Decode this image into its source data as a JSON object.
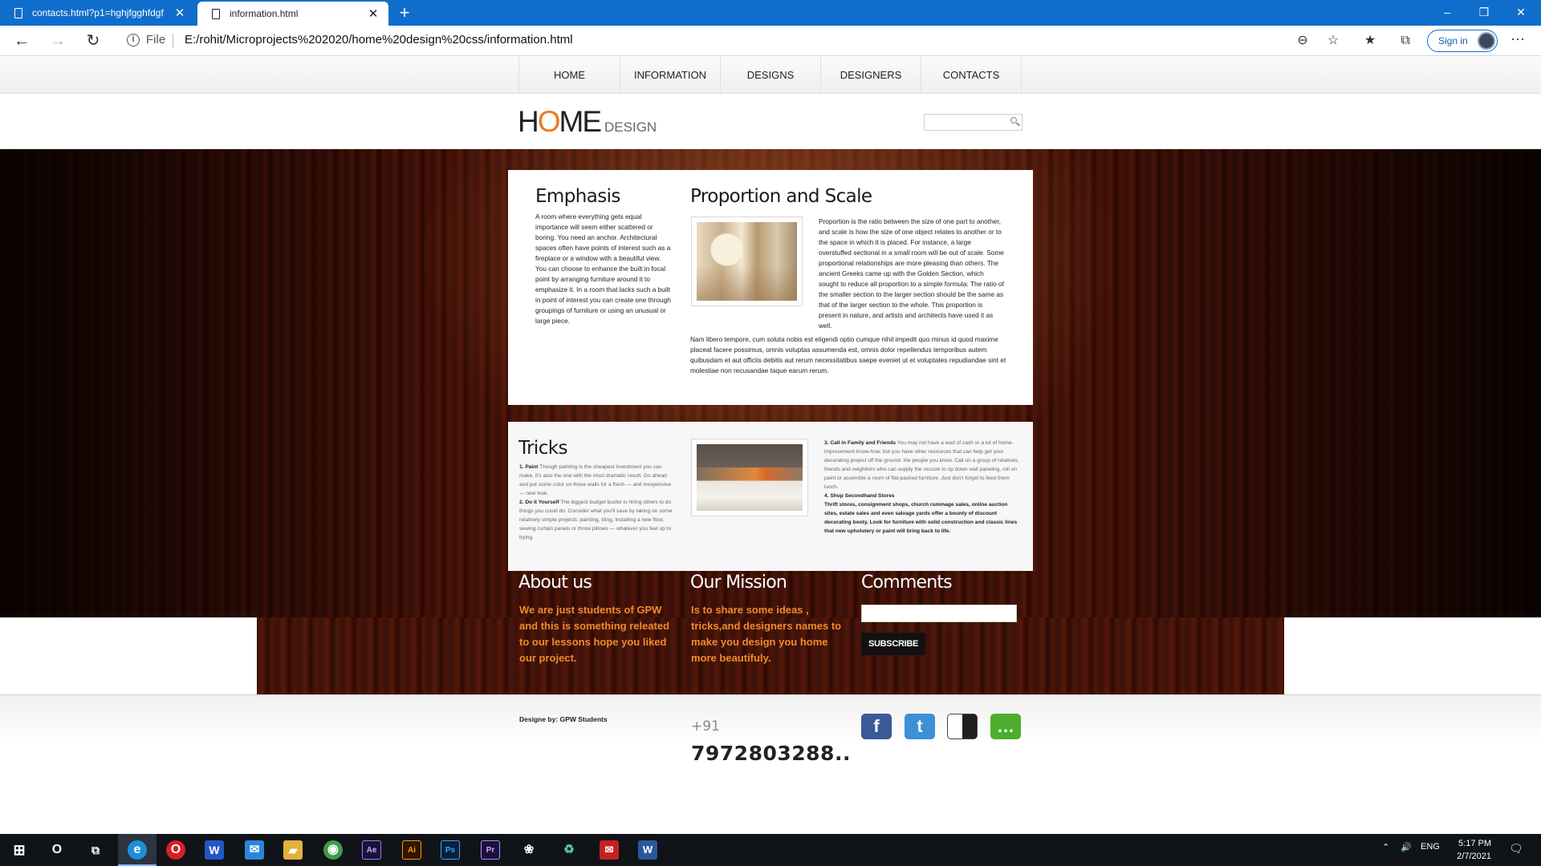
{
  "browser": {
    "tabs": [
      {
        "title": "contacts.html?p1=hghjfgghfdgf",
        "active": false
      },
      {
        "title": "information.html",
        "active": true
      }
    ],
    "new_tab": "+",
    "window_controls": {
      "minimize": "–",
      "restore": "❐",
      "close": "✕"
    },
    "nav": {
      "back": "←",
      "forward": "→",
      "refresh": "↻"
    },
    "address": {
      "scheme_label": "File",
      "url": "E:/rohit/Microprojects%202020/home%20design%20css/information.html"
    },
    "sign_in": "Sign in",
    "more": "···"
  },
  "site": {
    "nav": [
      "HOME",
      "INFORMATION",
      "DESIGNS",
      "DESIGNERS",
      "CONTACTS"
    ],
    "logo": {
      "part1": "H",
      "part_o": "O",
      "part2": "ME",
      "sub": "DESIGN"
    },
    "emphasis": {
      "title": "Emphasis",
      "text": "A room where everything gets equal importance will seem either scattered or boring. You need an anchor. Architectural spaces often have points of interest such as a fireplace or a window with a beautiful view. You can choose to enhance the built in focal point by arranging furniture around it to emphasize it. In a room that lacks such a built in point of interest you can create one through groupings of furniture or using an unusual or large piece."
    },
    "proportion": {
      "title": "Proportion and Scale",
      "text": "Proportion is the ratio between the size of one part to another, and scale is how the size of one object relates to another or to the space in which it is placed. For instance, a large overstuffed sectional in a small room will be out of scale. Some proportional relationships are more pleasing than others. The ancient Greeks came up with the Golden Section, which sought to reduce all proportion to a simple formula: The ratio of the smaller section to the larger section should be the same as that of the larger section to the whole. This proportion is present in nature, and artists and architects have used it as well.",
      "text2": "Nam libero tempore, cum soluta nobis est eligendi optio cumque nihil impedit quo minus id quod maxime placeat facere possimus, omnis voluptas assumenda est, omnis dolor repellendus temporibus autem quibusdam et aut officiis debitis aut rerum necessitatibus saepe eveniet ut et voluptates repudiandae sint et molestiae non recusandae taque earum rerum."
    },
    "tricks": {
      "title": "Tricks",
      "item1_head": "1. Paint",
      "item1_text": "Though painting is the cheapest investment you can make, it's also the one with the most dramatic result. Go ahead and put some color on those walls for a fresh — and inexpensive — new look.",
      "item2_head": "2. Do it Yourself",
      "item2_text": "The biggest budget buster is hiring others to do things you could do. Consider what you'll save by taking on some relatively simple projects: painting, tiling, installing a new floor, sewing curtain panels or throw pillows — whatever you feel up to trying.",
      "item3_head": "3. Call in Family and Friends",
      "item3_text": "You may not have a wad of cash or a lot of home-improvement know-how, but you have other resources that can help get your decorating project off the ground: the people you know. Call on a group of relatives, friends and neighbors who can supply the muscle to rip down wall paneling, roll on paint or assemble a room of flat-packed furniture. Just don't forget to feed them lunch.",
      "item4_head": "4. Shop Secondhand Stores",
      "item4_text": "Thrift stores, consignment shops, church rummage sales, online auction sites, estate sales and even salvage yards offer a bounty of discount decorating booty. Look for furniture with solid construction and classic lines that new upholstery or paint will bring back to life."
    },
    "about": {
      "title": "About us",
      "text": "We are just students of GPW and this is something releated to our lessons hope you liked our project."
    },
    "mission": {
      "title": "Our Mission",
      "text": "Is to share some ideas , tricks,and designers names to make you design you home more beautifuly."
    },
    "comments": {
      "title": "Comments",
      "button": "SUBSCRIBE"
    },
    "footer": {
      "credit": "Designe by: GPW Students",
      "phone_prefix": "+91",
      "phone_number": "7972803288..",
      "social": [
        {
          "name": "facebook",
          "glyph": "f",
          "color": "#3b5998"
        },
        {
          "name": "twitter",
          "glyph": "t",
          "color": "#3d8fd6"
        },
        {
          "name": "delicious",
          "glyph": "",
          "color": "#1f1f1f"
        },
        {
          "name": "chat",
          "glyph": "…",
          "color": "#4cae2c"
        }
      ]
    }
  },
  "taskbar": {
    "apps": [
      {
        "name": "Cortana",
        "label": "O",
        "color": "#101418"
      },
      {
        "name": "Task View",
        "label": "⧉",
        "color": "#101418"
      },
      {
        "name": "Edge",
        "label": "e",
        "color": "#1e8fd6"
      },
      {
        "name": "Opera",
        "label": "O",
        "color": "#d81f26"
      },
      {
        "name": "W",
        "label": "W",
        "color": "#2456c4"
      },
      {
        "name": "Mail",
        "label": "✉",
        "color": "#2b86d9"
      },
      {
        "name": "File Explorer",
        "label": "▰",
        "color": "#e2b23a"
      },
      {
        "name": "Chrome",
        "label": "◉",
        "color": "#3d9c48"
      },
      {
        "name": "After Effects",
        "label": "Ae",
        "color": "#1a1238"
      },
      {
        "name": "Illustrator",
        "label": "Ai",
        "color": "#2f1600"
      },
      {
        "name": "Photoshop",
        "label": "Ps",
        "color": "#0a1f3b"
      },
      {
        "name": "Premiere",
        "label": "Pr",
        "color": "#1f0f3a"
      },
      {
        "name": "App",
        "label": "❀",
        "color": "#101418"
      },
      {
        "name": "Recycle",
        "label": "♻",
        "color": "#101418"
      },
      {
        "name": "App Red",
        "label": "✉",
        "color": "#c42222"
      },
      {
        "name": "Word",
        "label": "W",
        "color": "#2b579a"
      }
    ],
    "tray": {
      "lang": "ENG",
      "time": "5:17 PM",
      "date": "2/7/2021"
    }
  }
}
